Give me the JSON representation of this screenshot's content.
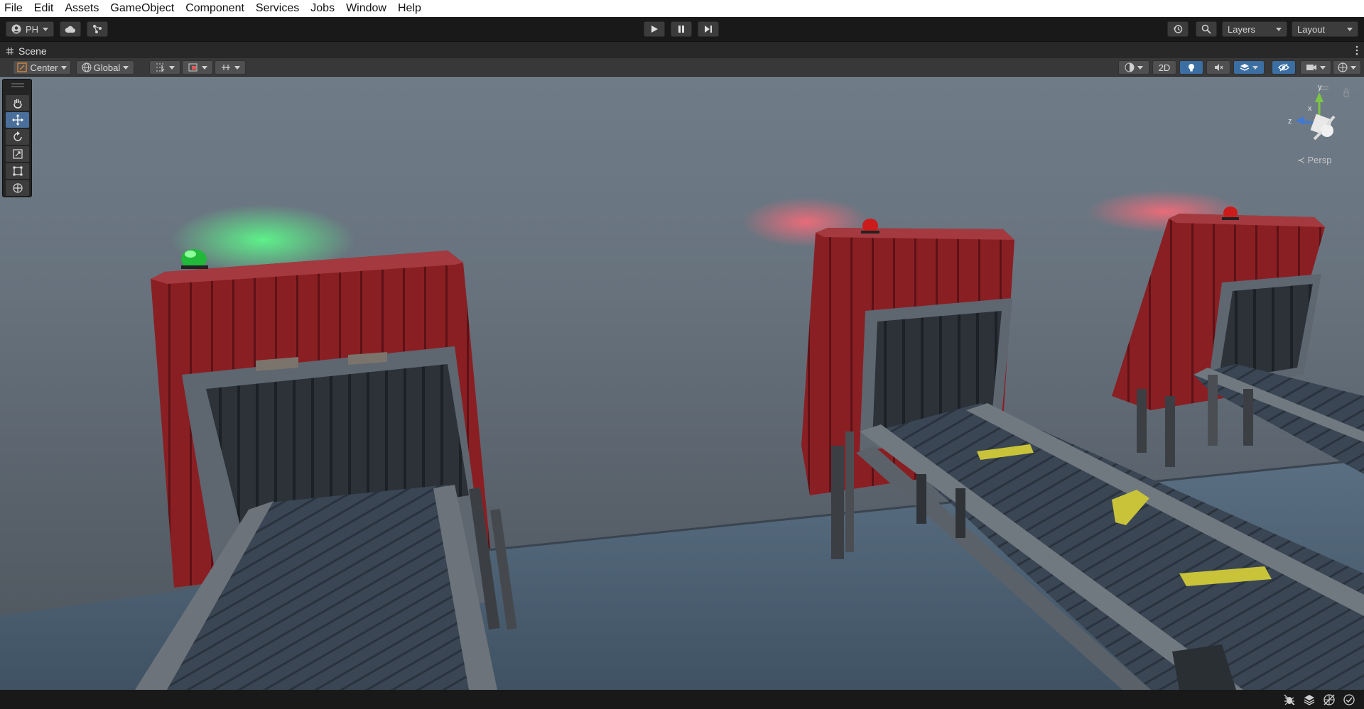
{
  "menu": [
    "File",
    "Edit",
    "Assets",
    "GameObject",
    "Component",
    "Services",
    "Jobs",
    "Window",
    "Help"
  ],
  "toolbar": {
    "account_label": "PH",
    "layers_label": "Layers",
    "layout_label": "Layout"
  },
  "scene_tab": {
    "label": "Scene"
  },
  "scene_toolbar": {
    "pivot_label": "Center",
    "space_label": "Global",
    "mode_2d_label": "2D"
  },
  "gizmo": {
    "x_label": "x",
    "y_label": "y",
    "z_label": "z",
    "projection_label": "Persp"
  },
  "colors": {
    "menubar_bg": "#ffffff",
    "toolbar_bg": "#191919",
    "accent_blue": "#3b6fa3",
    "booth_red": "#8a1f23",
    "beacon_green": "#2ed32e",
    "beacon_red": "#e81c1c",
    "part_yellow": "#c9c33a"
  }
}
